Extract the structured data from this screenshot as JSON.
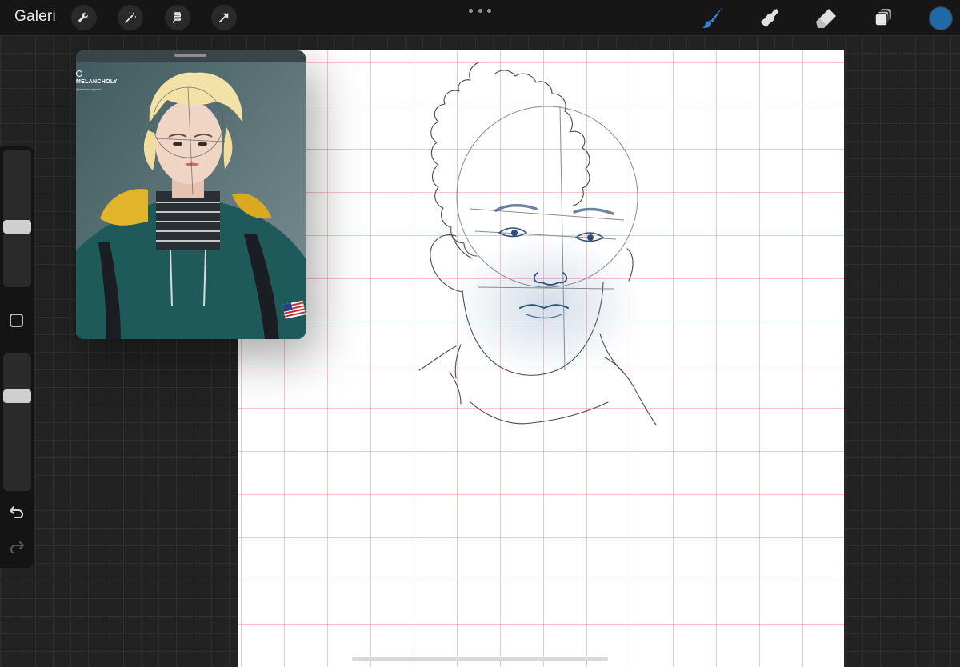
{
  "topbar": {
    "gallery_label": "Galeri",
    "left_tools": [
      {
        "name": "wrench-icon",
        "action": "Actions"
      },
      {
        "name": "magic-wand-icon",
        "action": "Adjustments"
      },
      {
        "name": "selection-icon",
        "action": "Selection"
      },
      {
        "name": "transform-arrow-icon",
        "action": "Transform"
      }
    ],
    "right_tools": [
      {
        "name": "brush-icon",
        "active": true
      },
      {
        "name": "smudge-icon",
        "active": false
      },
      {
        "name": "eraser-icon",
        "active": false
      },
      {
        "name": "layers-icon",
        "active": false
      }
    ],
    "current_color": "#1f6aa5",
    "active_tool_color": "#3a7fd6"
  },
  "reference": {
    "watermark": "MELANCHOLY",
    "watermark_sub": "@melancholyssed"
  },
  "sidebar": {
    "brush_size_level": 0.43,
    "opacity_level": 0.71
  },
  "canvas": {
    "grid_color": "#e89696",
    "stroke_color": "#3a3a3a",
    "shading_color": "#2c4f7a"
  }
}
